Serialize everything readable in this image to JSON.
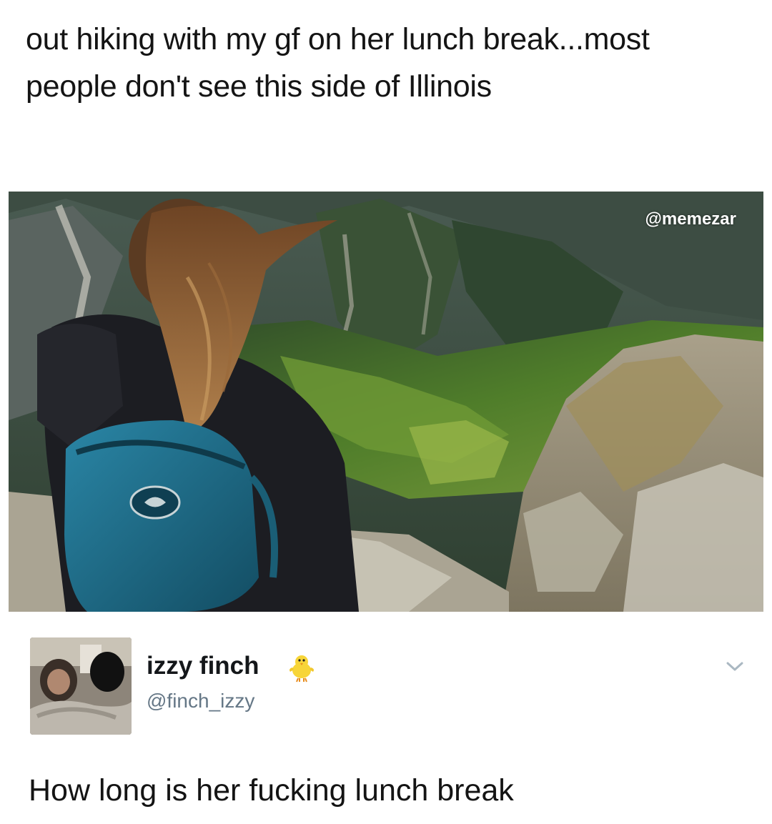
{
  "post": {
    "text": "out hiking with my gf on her lunch break...most people don't see this side of Illinois"
  },
  "photo": {
    "watermark": "@memezar"
  },
  "reply": {
    "display_name": "izzy finch",
    "handle": "@finch_izzy",
    "text": "How long is her fucking lunch break",
    "badge_icon": "baby-chick-icon",
    "menu_icon": "chevron-down-icon"
  },
  "colors": {
    "text": "#141414",
    "handle": "#657786",
    "chevron": "#aab8c2",
    "backpack": "#1f6f8b",
    "jacket": "#1c1d22",
    "hair": "#8a5a32",
    "valley_green": "#4f7d2a",
    "rock": "#b9b6a8"
  }
}
